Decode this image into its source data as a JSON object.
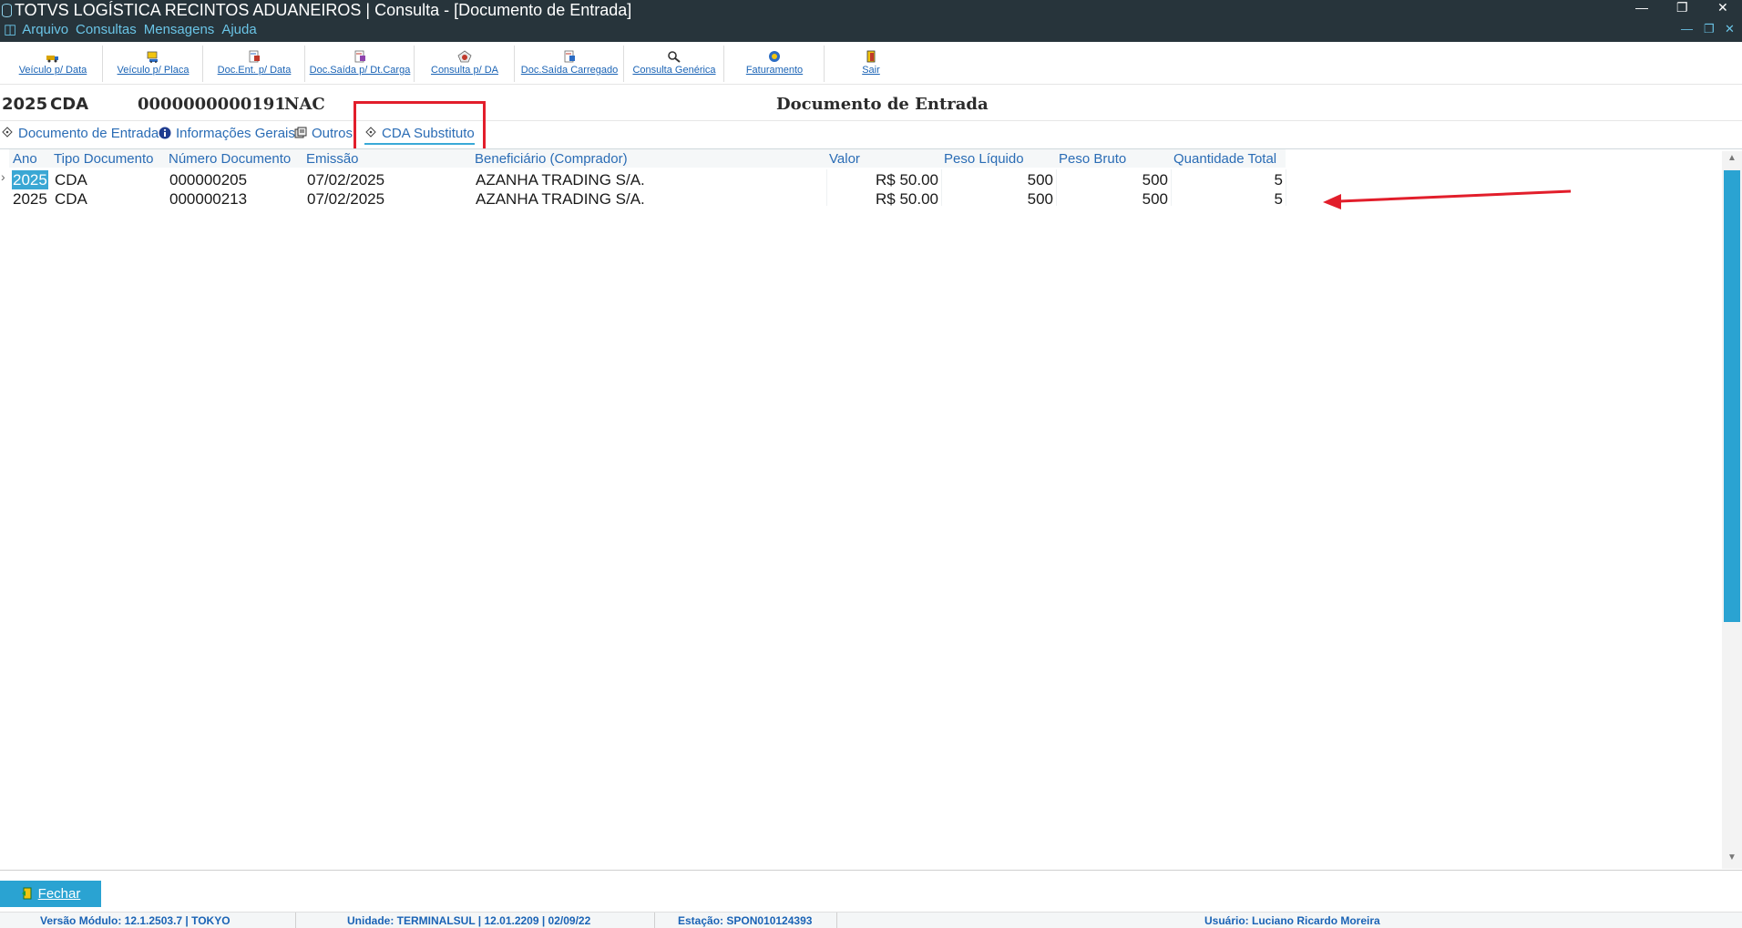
{
  "window": {
    "title": "TOTVS LOGÍSTICA RECINTOS ADUANEIROS | Consulta - [Documento de Entrada]",
    "controls": {
      "minimize": "—",
      "restore": "❐",
      "close": "✕"
    },
    "inner_controls": {
      "minimize": "—",
      "restore": "❐",
      "close": "✕"
    }
  },
  "menu": {
    "icon": "database-icon",
    "items": [
      "Arquivo",
      "Consultas",
      "Mensagens",
      "Ajuda"
    ]
  },
  "toolbar": {
    "buttons": [
      {
        "label": "Veículo p/ Data",
        "icon": "vehicle-date-icon"
      },
      {
        "label": "Veículo p/ Placa",
        "icon": "vehicle-plate-icon"
      },
      {
        "label": "Doc.Ent. p/ Data",
        "icon": "doc-entry-icon"
      },
      {
        "label": "Doc.Saída p/ Dt.Carga",
        "icon": "doc-exit-icon"
      },
      {
        "label": "Consulta p/ DA",
        "icon": "query-da-icon"
      },
      {
        "label": "Doc.Saída Carregado",
        "icon": "doc-loaded-icon"
      },
      {
        "label": "Consulta Genérica",
        "icon": "generic-query-icon"
      },
      {
        "label": "Faturamento",
        "icon": "billing-icon"
      },
      {
        "label": "Sair",
        "icon": "exit-icon"
      }
    ]
  },
  "header": {
    "year": "2025",
    "doc_type": "CDA",
    "doc_number": "0000000000191",
    "origin": "NAC",
    "title": "Documento de Entrada"
  },
  "tabs": [
    {
      "label": "Documento de Entrada",
      "icon": "document-tag-icon",
      "active": false
    },
    {
      "label": "Informações Gerais",
      "icon": "info-icon",
      "active": false
    },
    {
      "label": "Outros",
      "icon": "others-icon",
      "active": false
    },
    {
      "label": "CDA Substituto",
      "icon": "document-tag-icon",
      "active": true
    }
  ],
  "grid": {
    "columns": [
      "Ano",
      "Tipo Documento",
      "Número Documento",
      "Emissão",
      "Beneficiário (Comprador)",
      "Valor",
      "Peso Líquido",
      "Peso Bruto",
      "Quantidade Total"
    ],
    "rows": [
      {
        "ano": "2025",
        "tipo": "CDA",
        "numero": "000000205",
        "emissao": "07/02/2025",
        "beneficiario": "AZANHA TRADING S/A.",
        "valor": "R$ 50.00",
        "peso_liquido": "500",
        "peso_bruto": "500",
        "quantidade": "5"
      },
      {
        "ano": "2025",
        "tipo": "CDA",
        "numero": "000000213",
        "emissao": "07/02/2025",
        "beneficiario": "AZANHA TRADING S/A.",
        "valor": "R$ 50.00",
        "peso_liquido": "500",
        "peso_bruto": "500",
        "quantidade": "5"
      }
    ],
    "row_pointer": "›"
  },
  "footer": {
    "close_button": "Fechar"
  },
  "status": {
    "version": "Versão Módulo:  12.1.2503.7  |  TOKYO",
    "unit": "Unidade: TERMINALSUL | 12.01.2209 | 02/09/22",
    "station": "Estação: SPON010124393",
    "user": "Usuário: Luciano Ricardo Moreira"
  },
  "colors": {
    "titlebar": "#27343b",
    "accent": "#2aa3d2",
    "link": "#2a6cb5",
    "annotation": "#e21e2b"
  }
}
